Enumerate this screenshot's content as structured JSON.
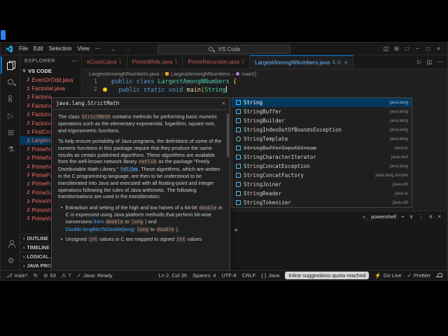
{
  "colors": {
    "accent": "#0078d4",
    "selection_bg": "#04395e",
    "error_red": "#f14c4c",
    "link_blue": "#4daafc",
    "keyword_blue": "#569cd6",
    "class_teal": "#4ec9b0",
    "function_yellow": "#dcdcaa",
    "file_error": "#ef6d64",
    "active_tab_blue": "#6cb6ff",
    "pill_bg": "#d6d6d6"
  },
  "titlebar": {
    "menus": [
      "File",
      "Edit",
      "Selection",
      "View",
      "⋯"
    ],
    "command_center": "VS Code",
    "layout_controls": [
      "toggle-sidebar",
      "toggle-panel",
      "customize-layout"
    ],
    "window_controls": [
      "minimize",
      "maximize",
      "close"
    ]
  },
  "activity": {
    "top": [
      {
        "name": "explorer",
        "active": true
      },
      {
        "name": "search"
      },
      {
        "name": "source-control"
      },
      {
        "name": "run-debug"
      },
      {
        "name": "extensions"
      },
      {
        "name": "testing"
      }
    ],
    "bottom": [
      {
        "name": "account"
      },
      {
        "name": "settings"
      }
    ]
  },
  "explorer": {
    "header": "EXPLORER",
    "section": "VS CODE",
    "files": [
      {
        "name": "EvenOrOdd.java"
      },
      {
        "name": "Factorial.java"
      },
      {
        "name": "Factoria"
      },
      {
        "name": "Factoria"
      },
      {
        "name": "Factoria"
      },
      {
        "name": "Factoria"
      },
      {
        "name": "FirstCod"
      },
      {
        "name": "LargestA",
        "selected": true
      },
      {
        "name": "PrimeNu"
      },
      {
        "name": "PrimeNu"
      },
      {
        "name": "PrimeNu"
      },
      {
        "name": "PrimePa"
      },
      {
        "name": "PrimeRe"
      },
      {
        "name": "PrimeSu"
      },
      {
        "name": "PrimeWh"
      },
      {
        "name": "PrimeWh"
      },
      {
        "name": "PrimeWh"
      }
    ],
    "bottom_sections": [
      "OUTLINE",
      "TIMELINE",
      "LOGICAL...",
      "JAVA PRO..."
    ]
  },
  "editor": {
    "tabs": [
      {
        "name": "eCount.java",
        "badge": "1"
      },
      {
        "name": "PrimeWhile.java",
        "badge": "1"
      },
      {
        "name": "PrimeRecursion.java",
        "badge": "1"
      },
      {
        "name": "LargestAmongNNumbers.java",
        "badge": "3, U",
        "active": true
      }
    ],
    "actions": [
      "run",
      "split-editor",
      "more-actions"
    ],
    "breadcrumbs": [
      {
        "label": "LargestAmongNNumbers.java"
      },
      {
        "label": "LargestAmongNNumbers",
        "icon": "class"
      },
      {
        "label": "main()",
        "icon": "method"
      }
    ],
    "lines": [
      {
        "number": "1",
        "segments": [
          [
            "kw",
            "public class "
          ],
          [
            "cls",
            "LargestAmongNNumbers"
          ],
          [
            "br",
            " {"
          ]
        ]
      },
      {
        "number": "2",
        "segments": [
          [
            "kw",
            "  public static void "
          ],
          [
            "fn",
            "main"
          ],
          [
            "br",
            "("
          ],
          [
            "cls",
            "String"
          ]
        ],
        "cursor": true,
        "lightbulb": true
      }
    ]
  },
  "hover": {
    "signature": "java.lang.StrictMath",
    "close_glyph": "×",
    "blocks": [
      {
        "type": "p",
        "segments": [
          [
            "t",
            "The class "
          ],
          [
            "c",
            "StrictMath"
          ],
          [
            "t",
            " contains methods for performing basic numeric operations such as the elementary exponential, logarithm, square root, and trigonometric functions."
          ]
        ]
      },
      {
        "type": "p",
        "segments": [
          [
            "t",
            "To help ensure portability of Java programs, the definitions of some of the numeric functions in this package require that they produce the same results as certain published algorithms. These algorithms are available from the well-known network library "
          ],
          [
            "c",
            "netlib"
          ],
          [
            "t",
            " as the package \"Freely Distributable Math Library,\" "
          ],
          [
            "lc",
            "fdlibm"
          ],
          [
            "t",
            ". These algorithms, which are written in the C programming language, are then to be understood to be transliterated into Java and executed with all floating-point and integer operations following the rules of Java arithmetic. The following transformations are used in the transliteration:"
          ]
        ]
      },
      {
        "type": "li",
        "segments": [
          [
            "t",
            "Extraction and setting of the high and low halves of a 64-bit "
          ],
          [
            "c",
            "double"
          ],
          [
            "t",
            " in C is expressed using Java platform methods that perform bit-wise conversions "
          ],
          [
            "l",
            "from"
          ],
          [
            "t",
            " "
          ],
          [
            "c",
            "double"
          ],
          [
            "t",
            " to "
          ],
          [
            "c",
            "long"
          ],
          [
            "t",
            " ) and "
          ],
          [
            "l",
            "Double.longBitsToDouble(long)"
          ],
          [
            "t",
            " "
          ],
          [
            "c",
            "long"
          ],
          [
            "t",
            " to "
          ],
          [
            "c",
            "double"
          ],
          [
            "t",
            " )."
          ]
        ]
      },
      {
        "type": "li",
        "segments": [
          [
            "t",
            "Unsigned "
          ],
          [
            "c",
            "int"
          ],
          [
            "t",
            " values in C are mapped to signed "
          ],
          [
            "c",
            "int"
          ],
          [
            "t",
            " values"
          ]
        ]
      }
    ]
  },
  "suggest": {
    "items": [
      {
        "label": "String",
        "detail": "java.lang",
        "kind": "class",
        "selected": true
      },
      {
        "label": "StringBuffer",
        "detail": "java.lang",
        "kind": "class"
      },
      {
        "label": "StringBuilder",
        "detail": "java.lang",
        "kind": "class"
      },
      {
        "label": "StringIndexOutOfBoundsException",
        "detail": "java.lang",
        "kind": "class"
      },
      {
        "label": "StringTemplate",
        "detail": "java.lang",
        "kind": "interface"
      },
      {
        "label": "StringBufferInputStream",
        "detail": "java.io",
        "kind": "class",
        "deprecated": true
      },
      {
        "label": "StringCharacterIterator",
        "detail": "java.text",
        "kind": "class"
      },
      {
        "label": "StringConcatException",
        "detail": "java.lang",
        "kind": "class"
      },
      {
        "label": "StringConcatFactory",
        "detail": "java.lang.invoke",
        "kind": "class"
      },
      {
        "label": "StringJoiner",
        "detail": "java.util",
        "kind": "class"
      },
      {
        "label": "StringReader",
        "detail": "java.io",
        "kind": "class"
      },
      {
        "label": "StringTokenizer",
        "detail": "java.util",
        "kind": "class"
      }
    ]
  },
  "panel": {
    "terminal_tab": "powershell",
    "prompt": ">",
    "actions": [
      "new-terminal",
      "chevron-down",
      "kebab",
      "chevron-up",
      "close"
    ]
  },
  "status": {
    "left": [
      {
        "icon": "branch",
        "label": "main*"
      },
      {
        "icon": "sync",
        "label": ""
      },
      {
        "icon": "error",
        "label": "63"
      },
      {
        "icon": "warning",
        "label": "7"
      },
      {
        "icon": "ok",
        "label": "Java: Ready"
      }
    ],
    "right": [
      {
        "label": "Ln 2, Col 35"
      },
      {
        "label": "Spaces: 4"
      },
      {
        "label": "UTF-8"
      },
      {
        "label": "CRLF"
      },
      {
        "icon": "braces",
        "label": "Java"
      },
      {
        "label": "Inline suggestions quota reached",
        "pill": true
      },
      {
        "icon": "bolt",
        "label": "Go Live"
      },
      {
        "icon": "check",
        "label": "Prettier"
      },
      {
        "icon": "bell",
        "label": ""
      }
    ]
  }
}
